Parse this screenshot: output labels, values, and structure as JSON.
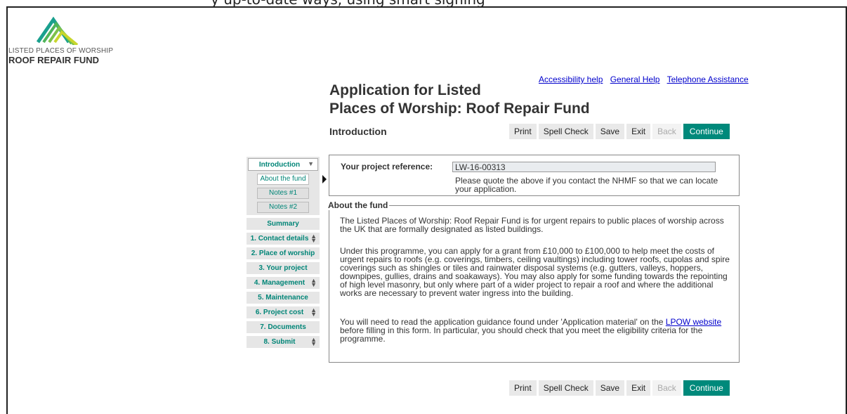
{
  "banner_fragment": "y up-to-date ways, using smart signing",
  "logo": {
    "line1": "LISTED PLACES OF WORSHIP",
    "line2": "ROOF REPAIR FUND",
    "colors": [
      "#1aa08e",
      "#7ec14a",
      "#c8d62c"
    ]
  },
  "help_links": [
    "Accessibility help",
    "General Help",
    "Telephone Assistance"
  ],
  "title": {
    "line1": "Application for Listed",
    "line2": "Places of Worship: Roof Repair Fund"
  },
  "section_label": "Introduction",
  "toolbar": {
    "print": "Print",
    "spell": "Spell Check",
    "save": "Save",
    "exit": "Exit",
    "back": "Back",
    "continue": "Continue"
  },
  "nav": {
    "group_label": "Introduction",
    "sub_items": [
      "About the fund",
      "Notes #1",
      "Notes #2"
    ],
    "items": [
      "Summary",
      "1. Contact details",
      "2. Place of worship",
      "3. Your project",
      "4. Management",
      "5. Maintenance",
      "6. Project cost",
      "7. Documents",
      "8. Submit"
    ]
  },
  "reference": {
    "label": "Your project reference:",
    "value": "LW-16-00313",
    "note": "Please quote the above if you contact the NHMF so that we can locate your application."
  },
  "about": {
    "legend": "About the fund",
    "p1": "The Listed Places of Worship: Roof Repair Fund is for urgent repairs to public places of worship across the UK that are formally designated as listed buildings.",
    "p2": "Under this programme, you can apply for a grant from £10,000 to £100,000 to help meet the costs of urgent repairs to roofs (e.g. coverings, timbers, ceiling vaultings) including tower roofs, cupolas and spire coverings such as shingles or tiles and rainwater disposal systems (e.g. gutters, valleys, hoppers, downpipes, gullies, drains and soakaways). You may also apply for some funding towards the repointing of high level masonry, but only where part of a wider project to repair a roof and where the additional works are necessary to prevent water ingress into the building.",
    "p3_before": "You will need to read the application guidance found under 'Application material' on the ",
    "p3_link": "LPOW website",
    "p3_after": " before filling in this form. In particular, you should check that you meet the eligibility criteria for the programme."
  }
}
